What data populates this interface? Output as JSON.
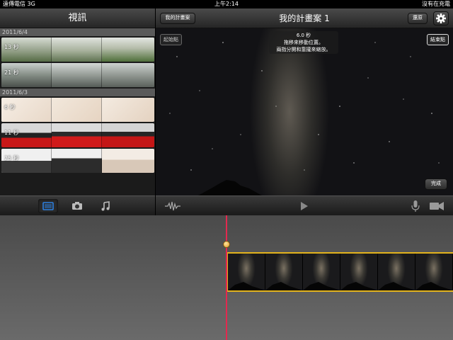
{
  "status": {
    "carrier": "遠傳電信  3G",
    "time": "上午2:14",
    "charging": "沒有在充電"
  },
  "browser": {
    "title": "視訊",
    "groups": [
      {
        "date": "2011/6/4",
        "clips": [
          {
            "duration": "13 秒"
          },
          {
            "duration": "21 秒"
          }
        ]
      },
      {
        "date": "2011/6/3",
        "clips": [
          {
            "duration": "6 秒"
          },
          {
            "duration": "11 秒"
          },
          {
            "duration": "25 秒"
          }
        ]
      }
    ],
    "tabs": [
      "video-icon",
      "camera-icon",
      "music-icon"
    ]
  },
  "project": {
    "back_label": "我的計畫案",
    "title": "我的計畫案 1",
    "undo_label": "還原",
    "settings_icon": "gear-icon"
  },
  "viewer": {
    "start_label": "起始點",
    "end_label": "結束點",
    "info_duration": "6.0 秒",
    "info_line1": "拖移來移動位置。",
    "info_line2": "兩指分開和靠攏來縮放。",
    "done_label": "完成"
  },
  "controls": [
    "waveform-icon",
    "play-icon",
    "microphone-icon",
    "video-camera-icon"
  ],
  "colors": {
    "playhead": "#e2294f",
    "selection": "#e2b21c",
    "tab_active": "#2c7fe0"
  }
}
